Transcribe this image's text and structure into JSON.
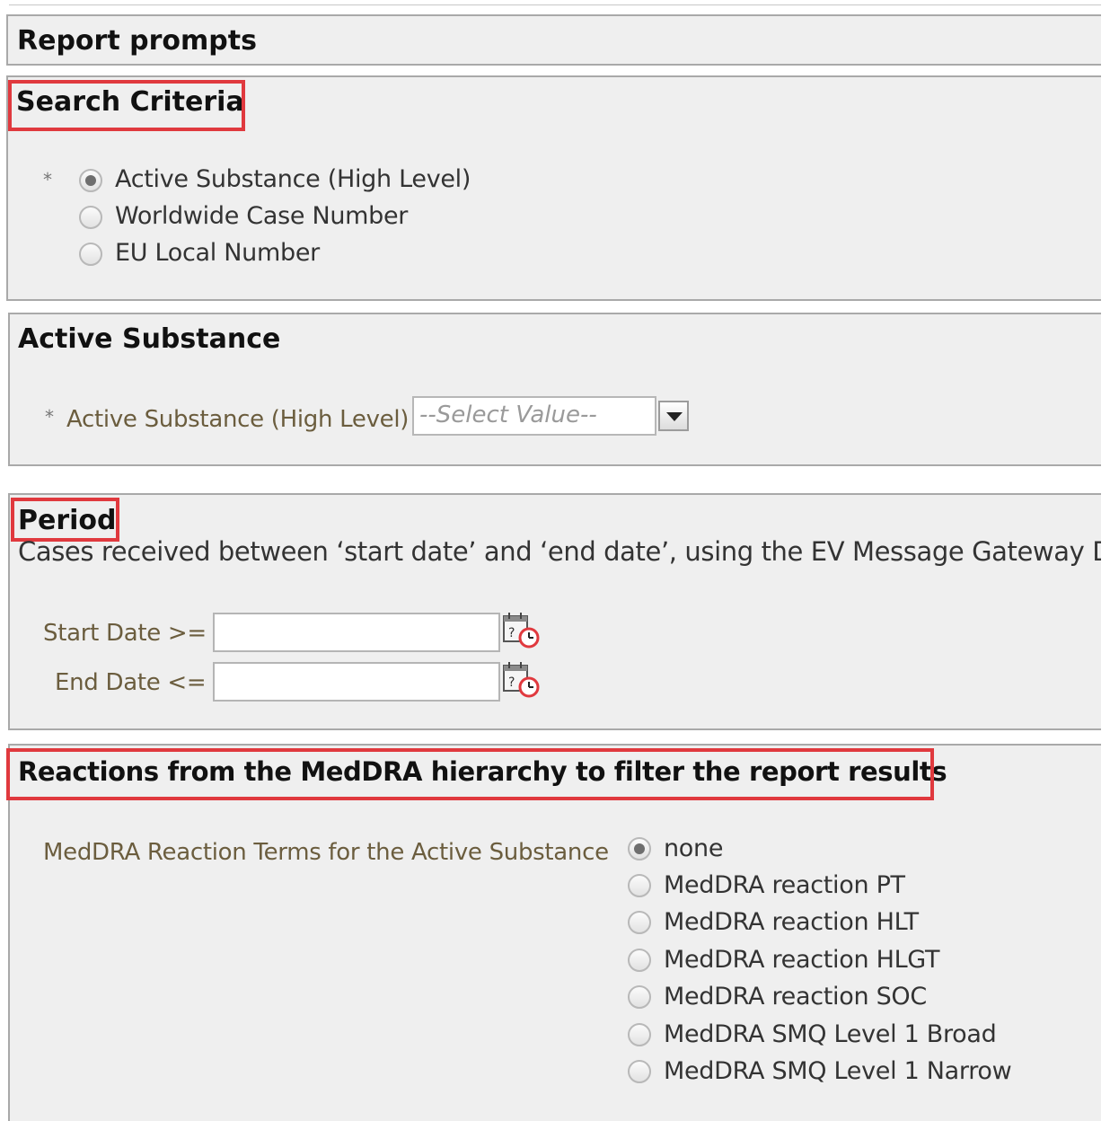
{
  "header": {
    "title": "Report prompts"
  },
  "search_criteria": {
    "title": "Search Criteria",
    "required_mark": "*",
    "options": [
      {
        "label": "Active Substance (High Level)",
        "selected": true
      },
      {
        "label": "Worldwide Case Number",
        "selected": false
      },
      {
        "label": "EU Local Number",
        "selected": false
      }
    ]
  },
  "active_substance": {
    "title": "Active Substance",
    "required_mark": "*",
    "field_label": "Active Substance (High Level)",
    "select_placeholder": "--Select Value--"
  },
  "period": {
    "title": "Period",
    "description": "Cases received between ‘start date’ and ‘end date’, using the EV Message Gateway Date",
    "start_label": "Start Date >=",
    "start_value": "",
    "end_label": "End Date <=",
    "end_value": "",
    "calendar_icon": "calendar-clock-icon"
  },
  "reactions": {
    "title": "Reactions from the MedDRA hierarchy to filter the report results",
    "field_label": "MedDRA Reaction Terms for the Active Substance",
    "options": [
      {
        "label": "none",
        "selected": true
      },
      {
        "label": "MedDRA reaction PT",
        "selected": false
      },
      {
        "label": "MedDRA reaction HLT",
        "selected": false
      },
      {
        "label": "MedDRA reaction HLGT",
        "selected": false
      },
      {
        "label": "MedDRA reaction SOC",
        "selected": false
      },
      {
        "label": "MedDRA SMQ Level 1 Broad",
        "selected": false
      },
      {
        "label": "MedDRA SMQ Level 1 Narrow",
        "selected": false
      }
    ]
  },
  "colors": {
    "highlight": "#e0393e",
    "panel_bg": "#efefef",
    "label": "#6b5d3e"
  }
}
